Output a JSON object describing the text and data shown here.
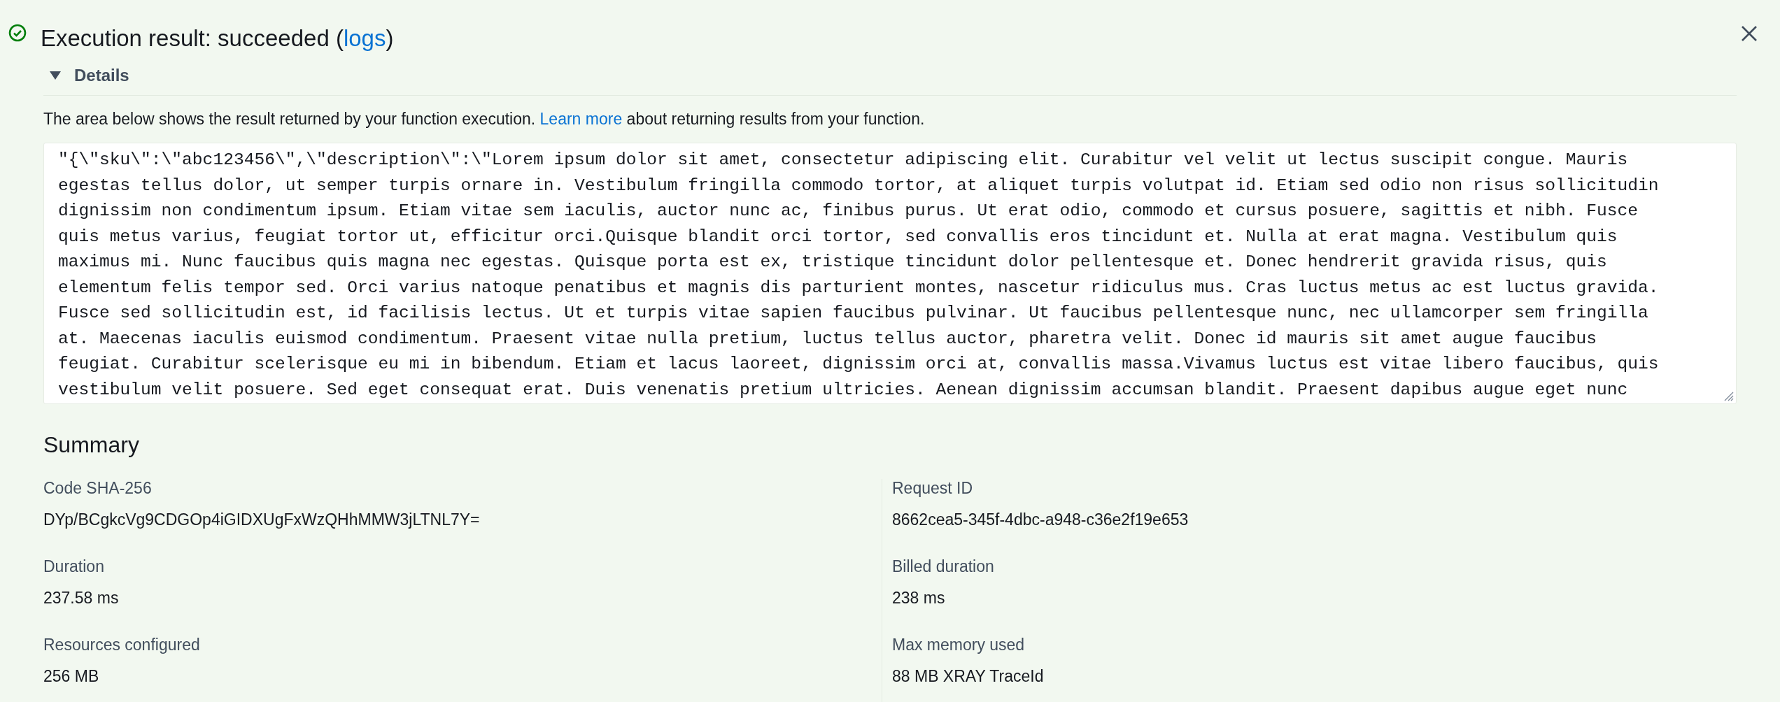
{
  "header": {
    "title": "Execution result: succeeded (",
    "link": "logs",
    "title_end": ")"
  },
  "details": {
    "label": "Details",
    "expanded": true,
    "description": "The area below shows the result returned by your function execution.",
    "description_link": "Learn more",
    "description_end": "about returning results from your function.",
    "result_lines": [
      "\"{\\\"sku\\\":\\\"abc123456\\\",\\\"description\\\":\\\"Lorem ipsum dolor sit amet, consectetur adipiscing elit. Curabitur vel velit ut lectus suscipit congue. Mauris",
      "egestas tellus dolor, ut semper turpis ornare in. Vestibulum fringilla commodo tortor, at aliquet turpis volutpat id. Etiam sed odio non risus sollicitudin",
      "dignissim non condimentum ipsum. Etiam vitae sem iaculis, auctor nunc ac, finibus purus. Ut erat odio, commodo et cursus posuere, sagittis et nibh. Fusce",
      "quis metus varius, feugiat tortor ut, efficitur orci.Quisque blandit orci tortor, sed convallis eros tincidunt et. Nulla at erat magna. Vestibulum quis",
      "maximus mi. Nunc faucibus quis magna nec egestas. Quisque porta est ex, tristique tincidunt dolor pellentesque et. Donec hendrerit gravida risus, quis",
      "elementum felis tempor sed. Orci varius natoque penatibus et magnis dis parturient montes, nascetur ridiculus mus. Cras luctus metus ac est luctus gravida.",
      "Fusce sed sollicitudin est, id facilisis lectus. Ut et turpis vitae sapien faucibus pulvinar. Ut faucibus pellentesque nunc, nec ullamcorper sem fringilla",
      "at. Maecenas iaculis euismod condimentum. Praesent vitae nulla pretium, luctus tellus auctor, pharetra velit. Donec id mauris sit amet augue faucibus",
      "feugiat. Curabitur scelerisque eu mi in bibendum. Etiam et lacus laoreet, dignissim orci at, convallis massa.Vivamus luctus est vitae libero faucibus, quis",
      "vestibulum velit posuere. Sed eget consequat erat. Duis venenatis pretium ultricies. Aenean dignissim accumsan blandit. Praesent dapibus augue eget nunc"
    ]
  },
  "summary": {
    "title": "Summary",
    "fields": [
      {
        "label": "Code SHA-256",
        "value": "DYp/BCgkcVg9CDGOp4iGIDXUgFxWzQHhMMW3jLTNL7Y="
      },
      {
        "label": "Request ID",
        "value": "8662cea5-345f-4dbc-a948-c36e2f19e653"
      },
      {
        "label": "Duration",
        "value": "237.58 ms"
      },
      {
        "label": "Billed duration",
        "value": "238 ms"
      },
      {
        "label": "Resources configured",
        "value": "256 MB"
      },
      {
        "label": "Max memory used",
        "value": "88 MB XRAY TraceId"
      }
    ]
  }
}
